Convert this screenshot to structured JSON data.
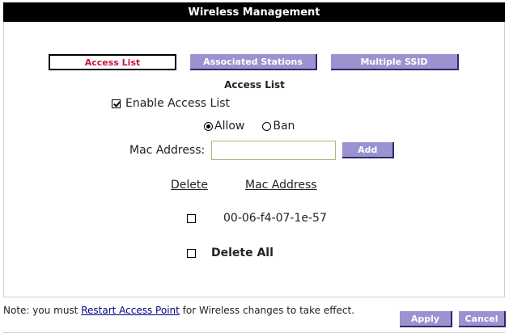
{
  "header": {
    "title": "Wireless Management"
  },
  "tabs": [
    {
      "label": "Access List",
      "active": true
    },
    {
      "label": "Associated Stations",
      "active": false
    },
    {
      "label": "Multiple SSID",
      "active": false
    }
  ],
  "section": {
    "title": "Access List"
  },
  "enable": {
    "label": "Enable Access List",
    "checked": true
  },
  "policy": {
    "options": [
      {
        "label": "Allow",
        "selected": true
      },
      {
        "label": "Ban",
        "selected": false
      }
    ]
  },
  "mac_form": {
    "label": "Mac Address:",
    "value": "",
    "add_label": "Add"
  },
  "list": {
    "headers": {
      "delete": "Delete",
      "mac": "Mac Address"
    },
    "rows": [
      {
        "mac": "00-06-f4-07-1e-57",
        "checked": false
      }
    ],
    "delete_all_label": "Delete All"
  },
  "footer": {
    "note_prefix": "Note: you must ",
    "note_link": "Restart Access Point",
    "note_suffix": " for Wireless changes to take effect.",
    "apply_label": "Apply",
    "cancel_label": "Cancel"
  },
  "colors": {
    "title_bg": "#000000",
    "button_bg": "#9a93cf",
    "active_tab_text": "#c2173c",
    "link": "#000080"
  }
}
